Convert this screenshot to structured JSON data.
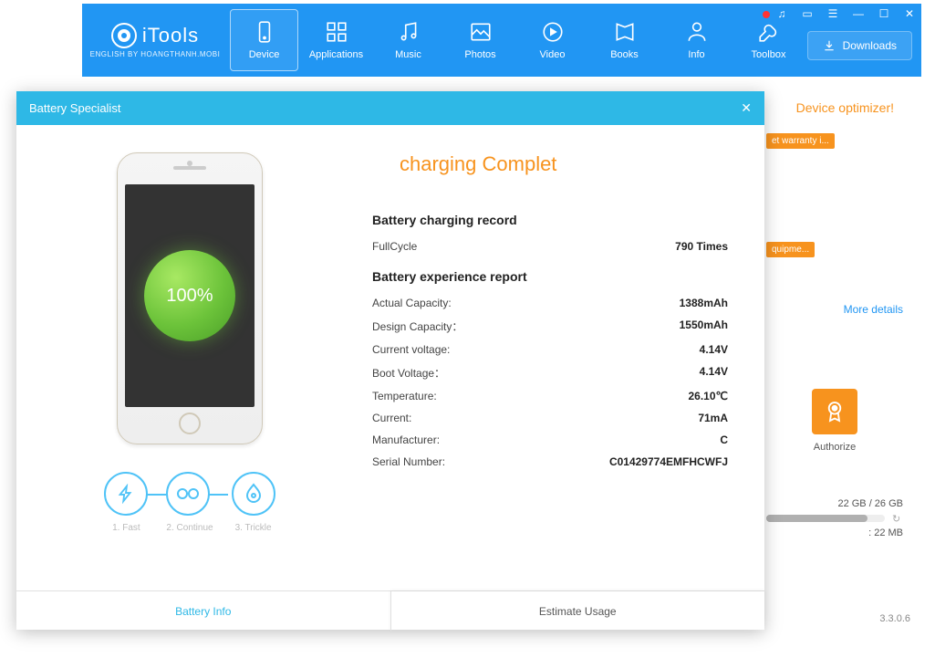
{
  "app": {
    "name": "iTools",
    "subtitle": "ENGLISH BY HOANGTHANH.MOBI",
    "version": "3.3.0.6"
  },
  "nav": [
    {
      "label": "Device"
    },
    {
      "label": "Applications"
    },
    {
      "label": "Music"
    },
    {
      "label": "Photos"
    },
    {
      "label": "Video"
    },
    {
      "label": "Books"
    },
    {
      "label": "Info"
    },
    {
      "label": "Toolbox"
    }
  ],
  "downloads_label": "Downloads",
  "promo": "Device optimizer!",
  "side": {
    "tag1": "et  warranty i...",
    "tag2": "quipme...",
    "more": "More details",
    "authorize": "Authorize",
    "storage_text": "22 GB / 26 GB",
    "storage_free": ": 22 MB"
  },
  "modal": {
    "title": "Battery Specialist",
    "status": "charging Complet",
    "percent": "100%",
    "phases": [
      {
        "label": "1. Fast"
      },
      {
        "label": "2. Continue"
      },
      {
        "label": "3. Trickle"
      }
    ],
    "tabs": {
      "info": "Battery Info",
      "usage": "Estimate Usage"
    },
    "record_h": "Battery charging record",
    "fullcycle_label": "FullCycle",
    "fullcycle_value": "790 Times",
    "report_h": "Battery experience report",
    "rows": [
      {
        "label": "Actual Capacity:",
        "value": "1388mAh"
      },
      {
        "label": "Design  Capacity：",
        "value": "1550mAh"
      },
      {
        "label": "Current voltage:",
        "value": "4.14V"
      },
      {
        "label": "Boot  Voltage：",
        "value": "4.14V"
      },
      {
        "label": "Temperature:",
        "value": "26.10℃"
      },
      {
        "label": "Current:",
        "value": "71mA"
      },
      {
        "label": "Manufacturer:",
        "value": "C"
      },
      {
        "label": "Serial Number:",
        "value": "C01429774EMFHCWFJ"
      }
    ]
  }
}
